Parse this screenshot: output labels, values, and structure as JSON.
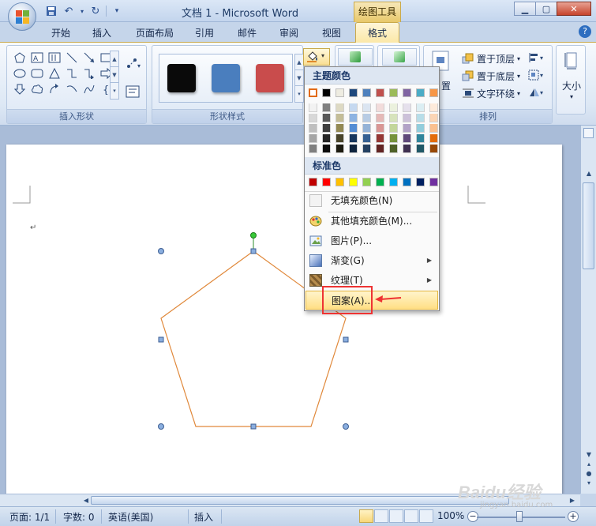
{
  "window": {
    "title": "文档 1 - Microsoft Word",
    "tools_tab": "绘图工具"
  },
  "tabs": [
    {
      "label": "开始",
      "active": false
    },
    {
      "label": "插入",
      "active": false
    },
    {
      "label": "页面布局",
      "active": false
    },
    {
      "label": "引用",
      "active": false
    },
    {
      "label": "邮件",
      "active": false
    },
    {
      "label": "审阅",
      "active": false
    },
    {
      "label": "视图",
      "active": false
    },
    {
      "label": "格式",
      "active": true
    }
  ],
  "ribbon": {
    "groups": {
      "insert_shapes": "插入形状",
      "shape_styles": "形状样式",
      "arrange": "排列"
    },
    "style_swatches": [
      "#0a0a0a",
      "#4a7ebe",
      "#c94c4c"
    ],
    "arrange": {
      "bring_front": "置于顶层",
      "send_back": "置于底层",
      "text_wrap": "文字环绕",
      "position_partial": "置"
    },
    "size_label": "大小"
  },
  "fill_menu": {
    "theme_colors_header": "主题颜色",
    "standard_colors_header": "标准色",
    "theme_top_row": [
      "#ffffff",
      "#000000",
      "#eeece1",
      "#1f497d",
      "#4f81bd",
      "#c0504d",
      "#9bbb59",
      "#8064a2",
      "#4bacc6",
      "#f79646"
    ],
    "theme_shades": [
      [
        "#f2f2f2",
        "#7f7f7f",
        "#ddd9c3",
        "#c6d9f0",
        "#dbe5f1",
        "#f2dcdb",
        "#ebf1dd",
        "#e5e0ec",
        "#dbeef3",
        "#fdeada"
      ],
      [
        "#d8d8d8",
        "#595959",
        "#c4bd97",
        "#8db3e2",
        "#b8cce4",
        "#e5b9b7",
        "#d7e3bc",
        "#ccc1d9",
        "#b7dde8",
        "#fbd5b5"
      ],
      [
        "#bfbfbf",
        "#3f3f3f",
        "#938953",
        "#548dd4",
        "#95b3d7",
        "#d99694",
        "#c3d69b",
        "#b2a2c7",
        "#92cddc",
        "#fac08f"
      ],
      [
        "#a5a5a5",
        "#262626",
        "#494429",
        "#17365d",
        "#366092",
        "#953734",
        "#76923c",
        "#5f497a",
        "#31859b",
        "#e36c09"
      ],
      [
        "#7f7f7f",
        "#0c0c0c",
        "#1d1b10",
        "#0f243e",
        "#244061",
        "#632423",
        "#4f6128",
        "#3f3151",
        "#205867",
        "#974806"
      ]
    ],
    "standard_colors": [
      "#c00000",
      "#ff0000",
      "#ffc000",
      "#ffff00",
      "#92d050",
      "#00b050",
      "#00b0f0",
      "#0070c0",
      "#002060",
      "#7030a0"
    ],
    "items": [
      {
        "label": "无填充颜色(N)",
        "icon": "no-fill-icon",
        "submenu": false
      },
      {
        "label": "其他填充颜色(M)...",
        "icon": "palette-icon",
        "submenu": false
      },
      {
        "label": "图片(P)...",
        "icon": "picture-icon",
        "submenu": false
      },
      {
        "label": "渐变(G)",
        "icon": "gradient-icon",
        "submenu": true
      },
      {
        "label": "纹理(T)",
        "icon": "texture-icon",
        "submenu": true
      },
      {
        "label": "图案(A)...",
        "icon": "pattern-icon",
        "submenu": false,
        "highlighted": true
      }
    ]
  },
  "document": {
    "paragraph_mark": "↵",
    "shape": "pentagon",
    "shape_outline_color": "#e0883a"
  },
  "status": {
    "page": "页面: 1/1",
    "words": "字数: 0",
    "language": "英语(美国)",
    "mode": "插入",
    "zoom": "100%"
  },
  "watermark": {
    "brand": "Baidu经验",
    "url": "jingyan.baidu.com"
  }
}
